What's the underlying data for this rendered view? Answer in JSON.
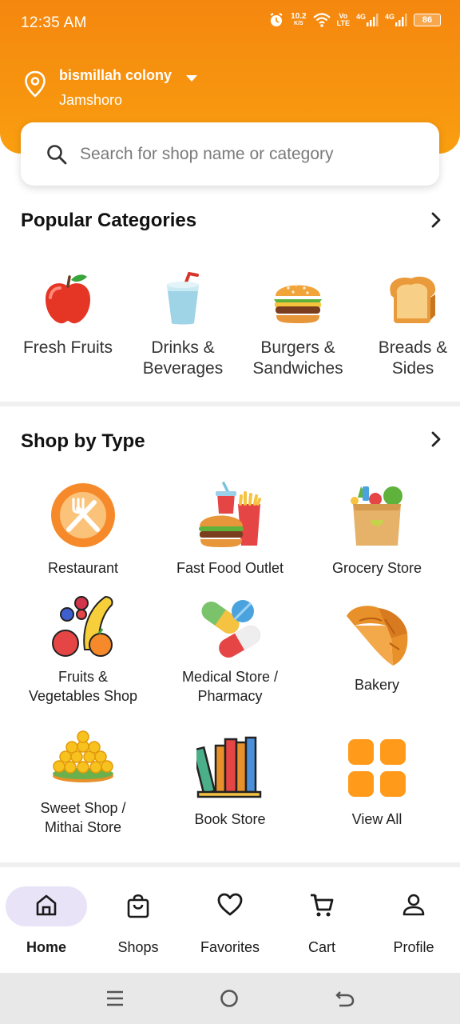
{
  "status_bar": {
    "time": "12:35 AM",
    "net_speed": "10.2",
    "net_unit": "K/S",
    "volte_top": "Vo",
    "volte_bottom": "LTE",
    "sim1": "4G",
    "sim2": "4G",
    "battery": "86"
  },
  "location": {
    "title": "bismillah colony",
    "subtitle": "Jamshoro"
  },
  "search": {
    "placeholder": "Search for shop name or category"
  },
  "popular_categories": {
    "title": "Popular Categories",
    "items": [
      {
        "label": "Fresh Fruits",
        "icon": "apple-icon"
      },
      {
        "label": "Drinks &\nBeverages",
        "icon": "drink-cup-icon"
      },
      {
        "label": "Burgers &\nSandwiches",
        "icon": "burger-icon"
      },
      {
        "label": "Breads &\nSides",
        "icon": "bread-icon"
      }
    ]
  },
  "shop_by_type": {
    "title": "Shop by Type",
    "items": [
      {
        "label": "Restaurant",
        "icon": "restaurant-icon"
      },
      {
        "label": "Fast Food Outlet",
        "icon": "fast-food-icon"
      },
      {
        "label": "Grocery Store",
        "icon": "grocery-bag-icon"
      },
      {
        "label": "Fruits &\nVegetables Shop",
        "icon": "fruits-icon"
      },
      {
        "label": "Medical Store /\nPharmacy",
        "icon": "pills-icon"
      },
      {
        "label": "Bakery",
        "icon": "croissant-icon"
      },
      {
        "label": "Sweet Shop /\nMithai Store",
        "icon": "sweets-icon"
      },
      {
        "label": "Book Store",
        "icon": "books-icon"
      },
      {
        "label": "View All",
        "icon": "grid-icon"
      }
    ]
  },
  "bottom_nav": {
    "items": [
      {
        "label": "Home",
        "icon": "home-icon",
        "active": true
      },
      {
        "label": "Shops",
        "icon": "shopping-bag-icon"
      },
      {
        "label": "Favorites",
        "icon": "heart-icon"
      },
      {
        "label": "Cart",
        "icon": "cart-icon"
      },
      {
        "label": "Profile",
        "icon": "person-icon"
      }
    ]
  },
  "colors": {
    "brand_orange": "#f7940f",
    "active_pill": "#e9e3f7",
    "view_all_orange": "#ff9a1a"
  }
}
